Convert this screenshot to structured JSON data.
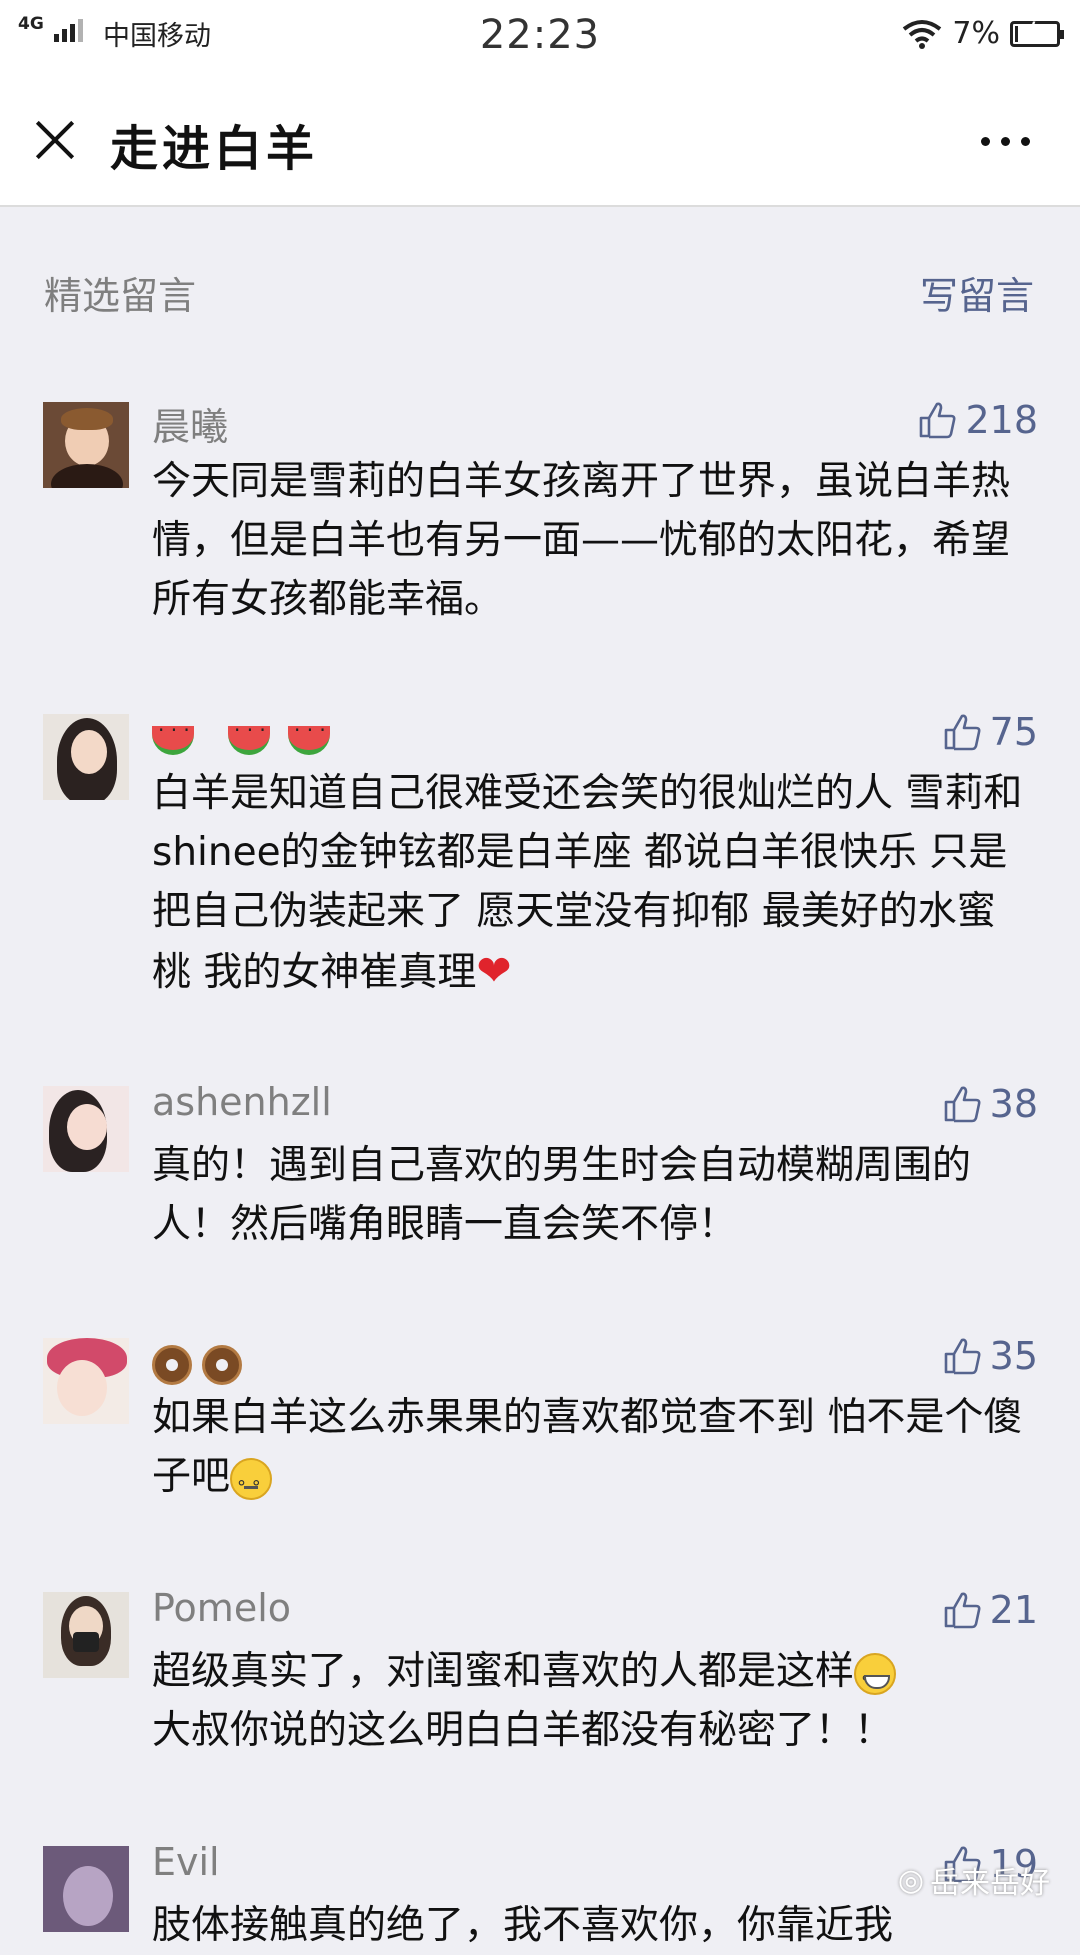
{
  "status_bar": {
    "network": "4G",
    "carrier": "中国移动",
    "time": "22:23",
    "battery": "7%",
    "battery_level": 0.07
  },
  "nav": {
    "title": "走进白羊"
  },
  "section": {
    "title": "精选留言",
    "write_label": "写留言"
  },
  "comments": [
    {
      "nickname": "晨曦",
      "likes": "218",
      "text": "今天同是雪莉的白羊女孩离开了世界，虽说白羊热情，但是白羊也有另一面——忧郁的太阳花，希望所有女孩都能幸福。"
    },
    {
      "nickname": "",
      "likes": "75",
      "text": "白羊是知道自己很难受还会笑的很灿烂的人 雪莉和shinee的金钟铉都是白羊座 都说白羊很快乐 只是把自己伪装起来了 愿天堂没有抑郁 最美好的水蜜桃 我的女神崔真理"
    },
    {
      "nickname": "ashenhzll",
      "likes": "38",
      "text": "真的！遇到自己喜欢的男生时会自动模糊周围的人！然后嘴角眼睛一直会笑不停！"
    },
    {
      "nickname": "",
      "likes": "35",
      "text": "如果白羊这么赤果果的喜欢都觉查不到 怕不是个傻子吧"
    },
    {
      "nickname": "Pomelo",
      "likes": "21",
      "text_line1": "超级真实了，对闺蜜和喜欢的人都是这样",
      "text_line2": "大叔你说的这么明白白羊都没有秘密了！！"
    },
    {
      "nickname": "Evil",
      "likes": "19",
      "text": "肢体接触真的绝了，我不喜欢你，你靠近我"
    }
  ],
  "icons": {
    "thumb": "thumbs-up-icon",
    "close": "close-icon",
    "more": "more-icon"
  },
  "watermark": "岳来岳好",
  "colors": {
    "link": "#56648e",
    "background": "#efeff4"
  }
}
